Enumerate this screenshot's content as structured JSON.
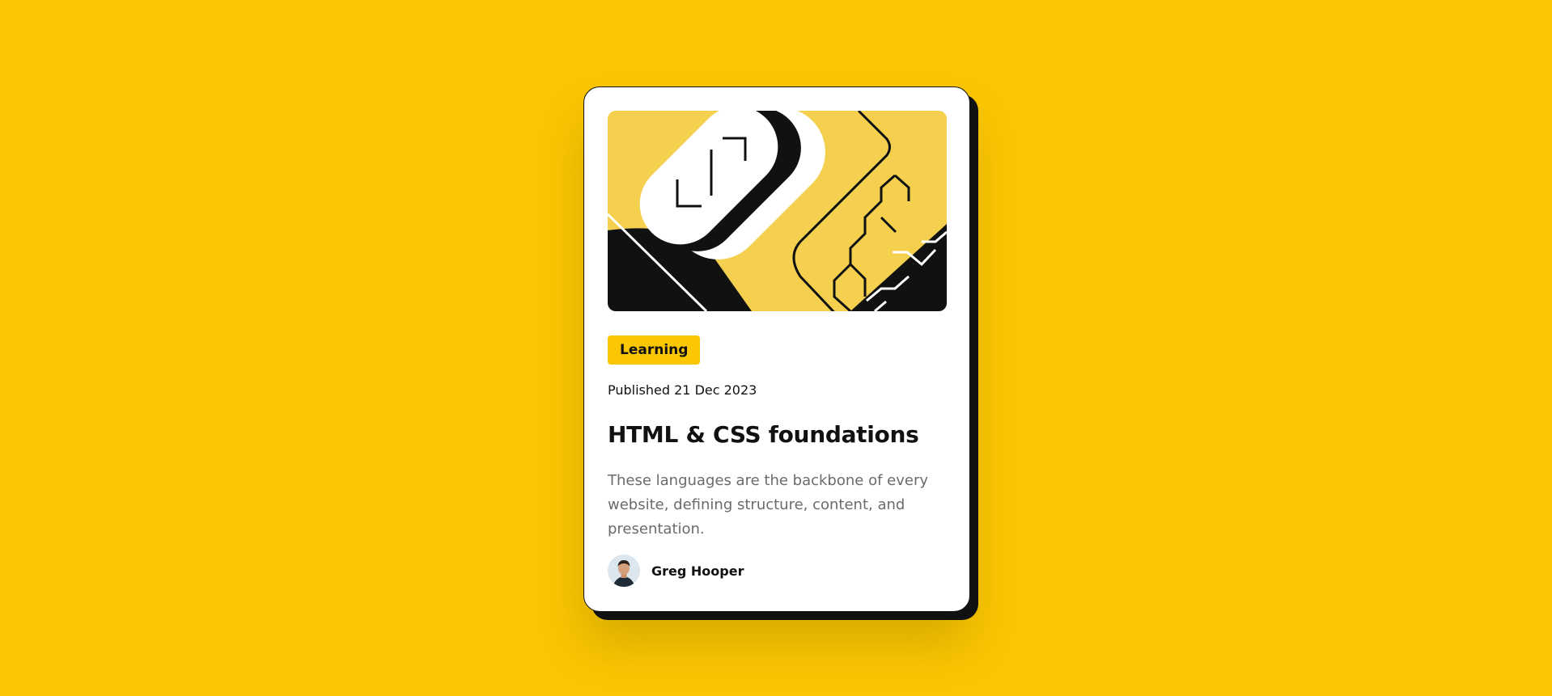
{
  "card": {
    "hero_image": "illustration-article",
    "category": "Learning",
    "published": "Published 21 Dec 2023",
    "title": "HTML & CSS foundations",
    "description": "These languages are the backbone of every website, defining structure, content, and presentation.",
    "author": {
      "name": "Greg Hooper",
      "avatar": "avatar-image"
    }
  },
  "colors": {
    "background": "#FBC602",
    "card": "#FFFFFF",
    "text": "#111111",
    "muted_text": "#6B6B6B",
    "illustration_bg": "#F4D04E"
  }
}
